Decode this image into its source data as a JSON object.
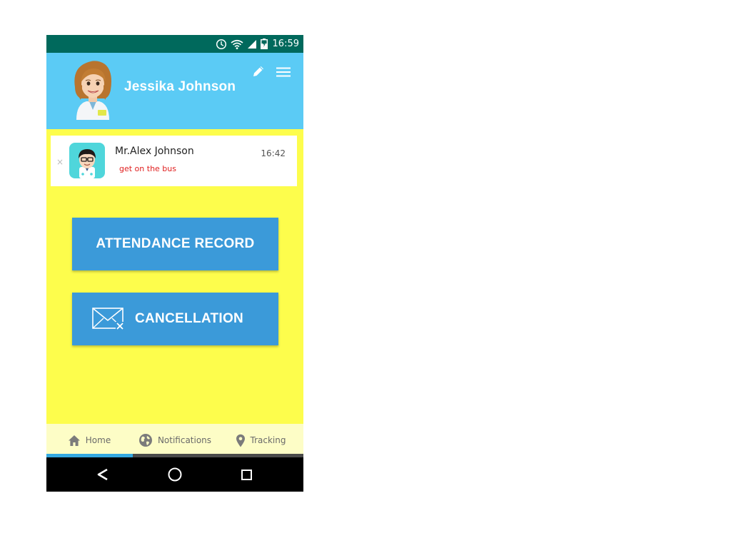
{
  "status_bar": {
    "time": "16:59",
    "icons": [
      "alarm-icon",
      "wifi-icon",
      "cell-signal-icon",
      "battery-charging-icon"
    ]
  },
  "header": {
    "user_name": "Jessika Johnson",
    "avatar_icon": "female-avatar-icon",
    "edit_icon": "pencil-icon",
    "menu_icon": "hamburger-menu-icon",
    "background_color": "#5bcbf5"
  },
  "notification": {
    "sender": "Mr.Alex Johnson",
    "time": "16:42",
    "message": "get on the bus",
    "dismiss_glyph": "×",
    "avatar_icon": "male-avatar-icon",
    "message_color": "#e02020"
  },
  "actions": {
    "attendance_label": "ATTENDANCE RECORD",
    "cancellation_label": "CANCELLATION",
    "cancellation_icon": "mail-cancel-icon",
    "button_color": "#3b9ad9"
  },
  "bottom_nav": {
    "items": [
      {
        "label": "Home",
        "icon": "home-icon",
        "active": true
      },
      {
        "label": "Notifications",
        "icon": "globe-icon",
        "active": false
      },
      {
        "label": "Tracking",
        "icon": "location-pin-icon",
        "active": false
      }
    ],
    "active_color": "#35a9e0"
  },
  "system_nav": {
    "icons": [
      "back-icon",
      "home-circle-icon",
      "recents-icon"
    ]
  },
  "page": {
    "background_color": "#fdfd4c"
  }
}
